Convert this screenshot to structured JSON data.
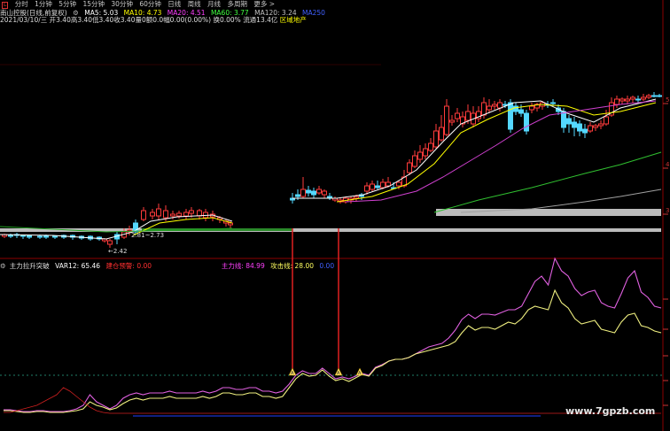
{
  "toolbar": {
    "l_label": "L",
    "periods": [
      "分时",
      "1分钟",
      "5分钟",
      "15分钟",
      "30分钟",
      "60分钟",
      "日线",
      "周线",
      "月线",
      "多周期",
      "更多 >"
    ]
  },
  "ma_line": {
    "stock": "南山控股(日线,前复权)",
    "ma5": "MA5: 5.03",
    "ma10": "MA10: 4.73",
    "ma20": "MA20: 4.51",
    "ma60": "MA60: 3.77",
    "ma120": "MA120: 3.24",
    "ma250": "MA250",
    "colors": {
      "ma5": "#ffffff",
      "ma10": "#ffff00",
      "ma20": "#ff40ff",
      "ma60": "#40ff40",
      "ma120": "#a0a0a0",
      "ma250": "#4060ff"
    }
  },
  "info_line": {
    "date": "2021/03/10/三",
    "open": "开3.40",
    "high": "高3.40",
    "low": "低3.40",
    "close": "收3.40",
    "volume": "量0",
    "amount": "额0.0",
    "change": "幅0.00(0.00%)",
    "turnover": "换0.00%",
    "float": "流通13.4亿",
    "sector": "区域地产"
  },
  "price_axis": [
    "5",
    "4",
    "3"
  ],
  "low_annotation": "←2.42",
  "box_label": "2.81~2.73",
  "indicator": {
    "name": "主力拉升突破",
    "var12": "VAR12: 65.46",
    "warn": "建仓预警: 0.00",
    "main": "主力线: 84.99",
    "attack": "攻击线: 28.00",
    "extra": "0.00"
  },
  "watermark": "www.7gpzb.com",
  "chart_data": {
    "type": "line",
    "series": [
      {
        "name": "主力线",
        "values": [
          5,
          5,
          4,
          3,
          3,
          4,
          4,
          3,
          3,
          3,
          4,
          6,
          10,
          22,
          14,
          10,
          6,
          10,
          18,
          22,
          24,
          22,
          24,
          24,
          24,
          26,
          24,
          24,
          24,
          24,
          26,
          24,
          26,
          30,
          30,
          28,
          28,
          30,
          30,
          26,
          26,
          24,
          26,
          34,
          44,
          49,
          46,
          46,
          52,
          46,
          40,
          42,
          40,
          43,
          46,
          44,
          53,
          56,
          60,
          62,
          62,
          64,
          68,
          72,
          76,
          78,
          80,
          86,
          95,
          107,
          113,
          108,
          113,
          113,
          112,
          115,
          118,
          118,
          122,
          136,
          150,
          156,
          146,
          176,
          162,
          156,
          142,
          134,
          138,
          140,
          126,
          122,
          120,
          136,
          154,
          162,
          138,
          132,
          122,
          120
        ]
      },
      {
        "name": "攻击线",
        "values": [
          4,
          4,
          3,
          2,
          2,
          3,
          3,
          2,
          2,
          2,
          3,
          4,
          6,
          14,
          10,
          8,
          5,
          7,
          12,
          16,
          18,
          16,
          18,
          18,
          18,
          20,
          18,
          18,
          18,
          18,
          20,
          18,
          20,
          24,
          24,
          22,
          22,
          24,
          24,
          20,
          20,
          18,
          20,
          30,
          40,
          46,
          43,
          44,
          50,
          43,
          38,
          40,
          37,
          41,
          45,
          43,
          52,
          55,
          60,
          62,
          62,
          64,
          68,
          70,
          72,
          74,
          76,
          78,
          82,
          92,
          100,
          95,
          98,
          98,
          96,
          100,
          104,
          102,
          108,
          118,
          122,
          120,
          118,
          140,
          126,
          120,
          108,
          102,
          104,
          106,
          96,
          94,
          92,
          104,
          112,
          114,
          100,
          98,
          94,
          92
        ]
      },
      {
        "name": "建仓预警",
        "values": [
          2,
          2,
          4,
          6,
          8,
          10,
          14,
          18,
          22,
          30,
          26,
          20,
          14,
          8,
          4,
          2,
          1,
          1,
          1,
          1,
          1,
          1,
          1,
          1,
          1,
          1,
          1,
          1,
          1,
          1,
          1,
          1,
          1,
          1,
          1,
          1,
          1,
          1,
          1,
          1,
          1,
          1,
          1,
          1,
          1,
          1,
          1,
          1,
          1,
          1,
          1,
          1,
          1,
          1,
          1,
          1,
          1,
          1,
          1,
          1,
          1,
          1,
          1,
          1,
          1,
          1,
          1,
          1,
          1,
          1,
          1,
          1,
          1,
          1,
          1,
          1,
          1,
          1,
          1,
          1,
          1,
          1,
          1,
          1,
          1,
          1,
          1,
          1,
          1,
          1,
          1,
          1,
          1,
          1,
          1,
          1,
          1,
          1,
          1,
          1
        ]
      }
    ],
    "signals": [
      "A",
      "A",
      "A"
    ]
  }
}
